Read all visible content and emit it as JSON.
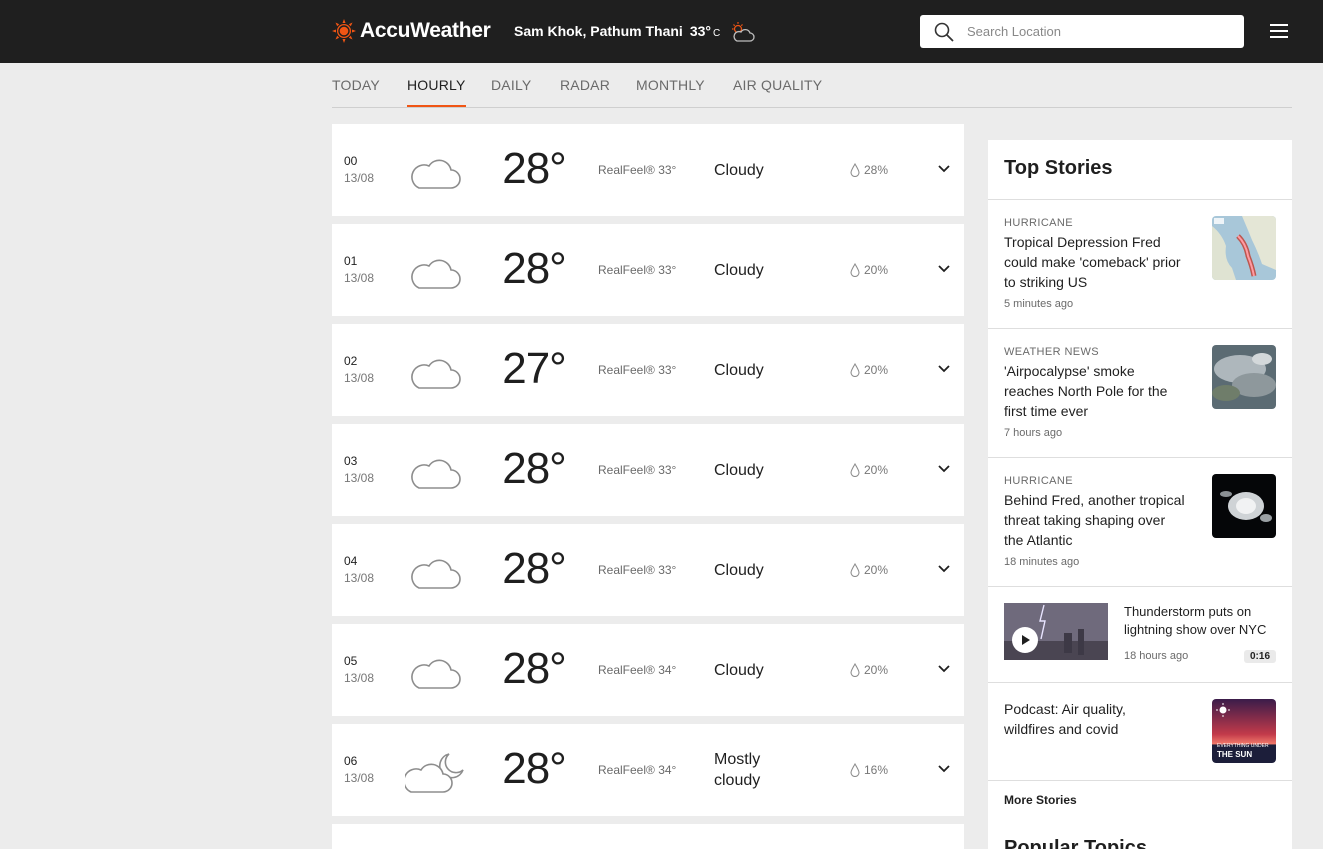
{
  "header": {
    "brand": "AccuWeather",
    "location": "Sam Khok, Pathum Thani",
    "current_temp": "33°",
    "unit": "C",
    "search_placeholder": "Search Location"
  },
  "tabs": [
    {
      "label": "TODAY",
      "active": false
    },
    {
      "label": "HOURLY",
      "active": true
    },
    {
      "label": "DAILY",
      "active": false
    },
    {
      "label": "RADAR",
      "active": false
    },
    {
      "label": "MONTHLY",
      "active": false
    },
    {
      "label": "AIR QUALITY",
      "active": false
    }
  ],
  "hourly": [
    {
      "hour": "00",
      "date": "13/08",
      "icon": "cloud-icon",
      "temp": "28°",
      "realfeel": "RealFeel® 33°",
      "phrase": "Cloudy",
      "precip": "28%"
    },
    {
      "hour": "01",
      "date": "13/08",
      "icon": "cloud-icon",
      "temp": "28°",
      "realfeel": "RealFeel® 33°",
      "phrase": "Cloudy",
      "precip": "20%"
    },
    {
      "hour": "02",
      "date": "13/08",
      "icon": "cloud-icon",
      "temp": "27°",
      "realfeel": "RealFeel® 33°",
      "phrase": "Cloudy",
      "precip": "20%"
    },
    {
      "hour": "03",
      "date": "13/08",
      "icon": "cloud-icon",
      "temp": "28°",
      "realfeel": "RealFeel® 33°",
      "phrase": "Cloudy",
      "precip": "20%"
    },
    {
      "hour": "04",
      "date": "13/08",
      "icon": "cloud-icon",
      "temp": "28°",
      "realfeel": "RealFeel® 33°",
      "phrase": "Cloudy",
      "precip": "20%"
    },
    {
      "hour": "05",
      "date": "13/08",
      "icon": "cloud-icon",
      "temp": "28°",
      "realfeel": "RealFeel® 34°",
      "phrase": "Cloudy",
      "precip": "20%"
    },
    {
      "hour": "06",
      "date": "13/08",
      "icon": "moon-cloud-icon",
      "temp": "28°",
      "realfeel": "RealFeel® 34°",
      "phrase_line1": "Mostly",
      "phrase_line2": "cloudy",
      "precip": "16%"
    }
  ],
  "top_stories": {
    "heading": "Top Stories",
    "stories": [
      {
        "category": "HURRICANE",
        "title": "Tropical Depression Fred could make 'comeback' prior to striking US",
        "time": "5 minutes ago"
      },
      {
        "category": "WEATHER NEWS",
        "title": "'Airpocalypse' smoke reaches North Pole for the first time ever",
        "time": "7 hours ago"
      },
      {
        "category": "HURRICANE",
        "title": "Behind Fred, another tropical threat taking shaping over the Atlantic",
        "time": "18 minutes ago"
      },
      {
        "title": "Thunderstorm puts on lightning show over NYC",
        "time": "18 hours ago",
        "duration": "0:16"
      },
      {
        "title": "Podcast: Air quality, wildfires and covid",
        "thumb_line1": "EVERYTHING UNDER",
        "thumb_line2": "THE SUN"
      }
    ],
    "more_label": "More Stories",
    "popular_heading": "Popular Topics"
  },
  "colors": {
    "accent": "#f05514",
    "header_bg": "#1f1f1f",
    "page_bg": "#ececec"
  }
}
